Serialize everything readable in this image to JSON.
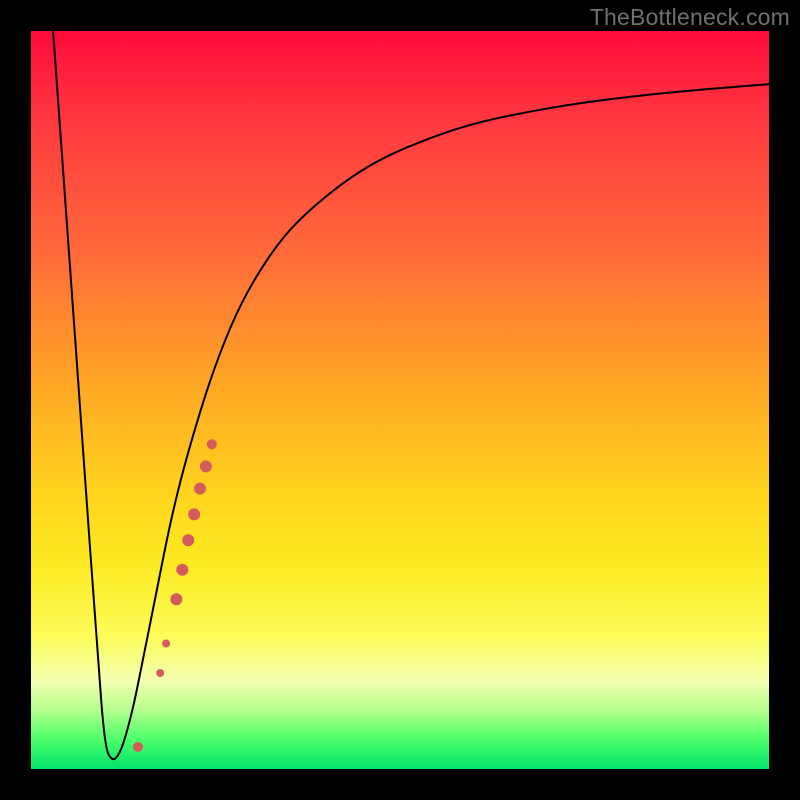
{
  "watermark": "TheBottleneck.com",
  "chart_data": {
    "type": "line",
    "title": "",
    "xlabel": "",
    "ylabel": "",
    "xlim": [
      0,
      100
    ],
    "ylim": [
      0,
      100
    ],
    "grid": false,
    "series": [
      {
        "name": "curve",
        "x": [
          3,
          5,
          7,
          9,
          10,
          11,
          12,
          13,
          14,
          15,
          17,
          19,
          21,
          24,
          27,
          30,
          34,
          38,
          43,
          48,
          54,
          60,
          67,
          74,
          82,
          90,
          100
        ],
        "y": [
          100,
          72,
          44,
          16,
          3,
          1,
          2,
          5,
          9,
          14,
          24,
          34,
          42,
          52,
          60,
          66,
          72,
          76,
          80,
          83,
          85.5,
          87.5,
          89,
          90.2,
          91.2,
          92,
          92.8
        ],
        "color": "#000000"
      }
    ],
    "markers": {
      "name": "highlight-points",
      "color": "#d45b5a",
      "points": [
        {
          "x": 14.5,
          "y": 3,
          "r": 5
        },
        {
          "x": 17.5,
          "y": 13,
          "r": 4
        },
        {
          "x": 18.3,
          "y": 17,
          "r": 4
        },
        {
          "x": 19.7,
          "y": 23,
          "r": 6
        },
        {
          "x": 20.5,
          "y": 27,
          "r": 6
        },
        {
          "x": 21.3,
          "y": 31,
          "r": 6
        },
        {
          "x": 22.1,
          "y": 34.5,
          "r": 6
        },
        {
          "x": 22.9,
          "y": 38,
          "r": 6
        },
        {
          "x": 23.7,
          "y": 41,
          "r": 6
        },
        {
          "x": 24.5,
          "y": 44,
          "r": 5
        }
      ]
    }
  }
}
